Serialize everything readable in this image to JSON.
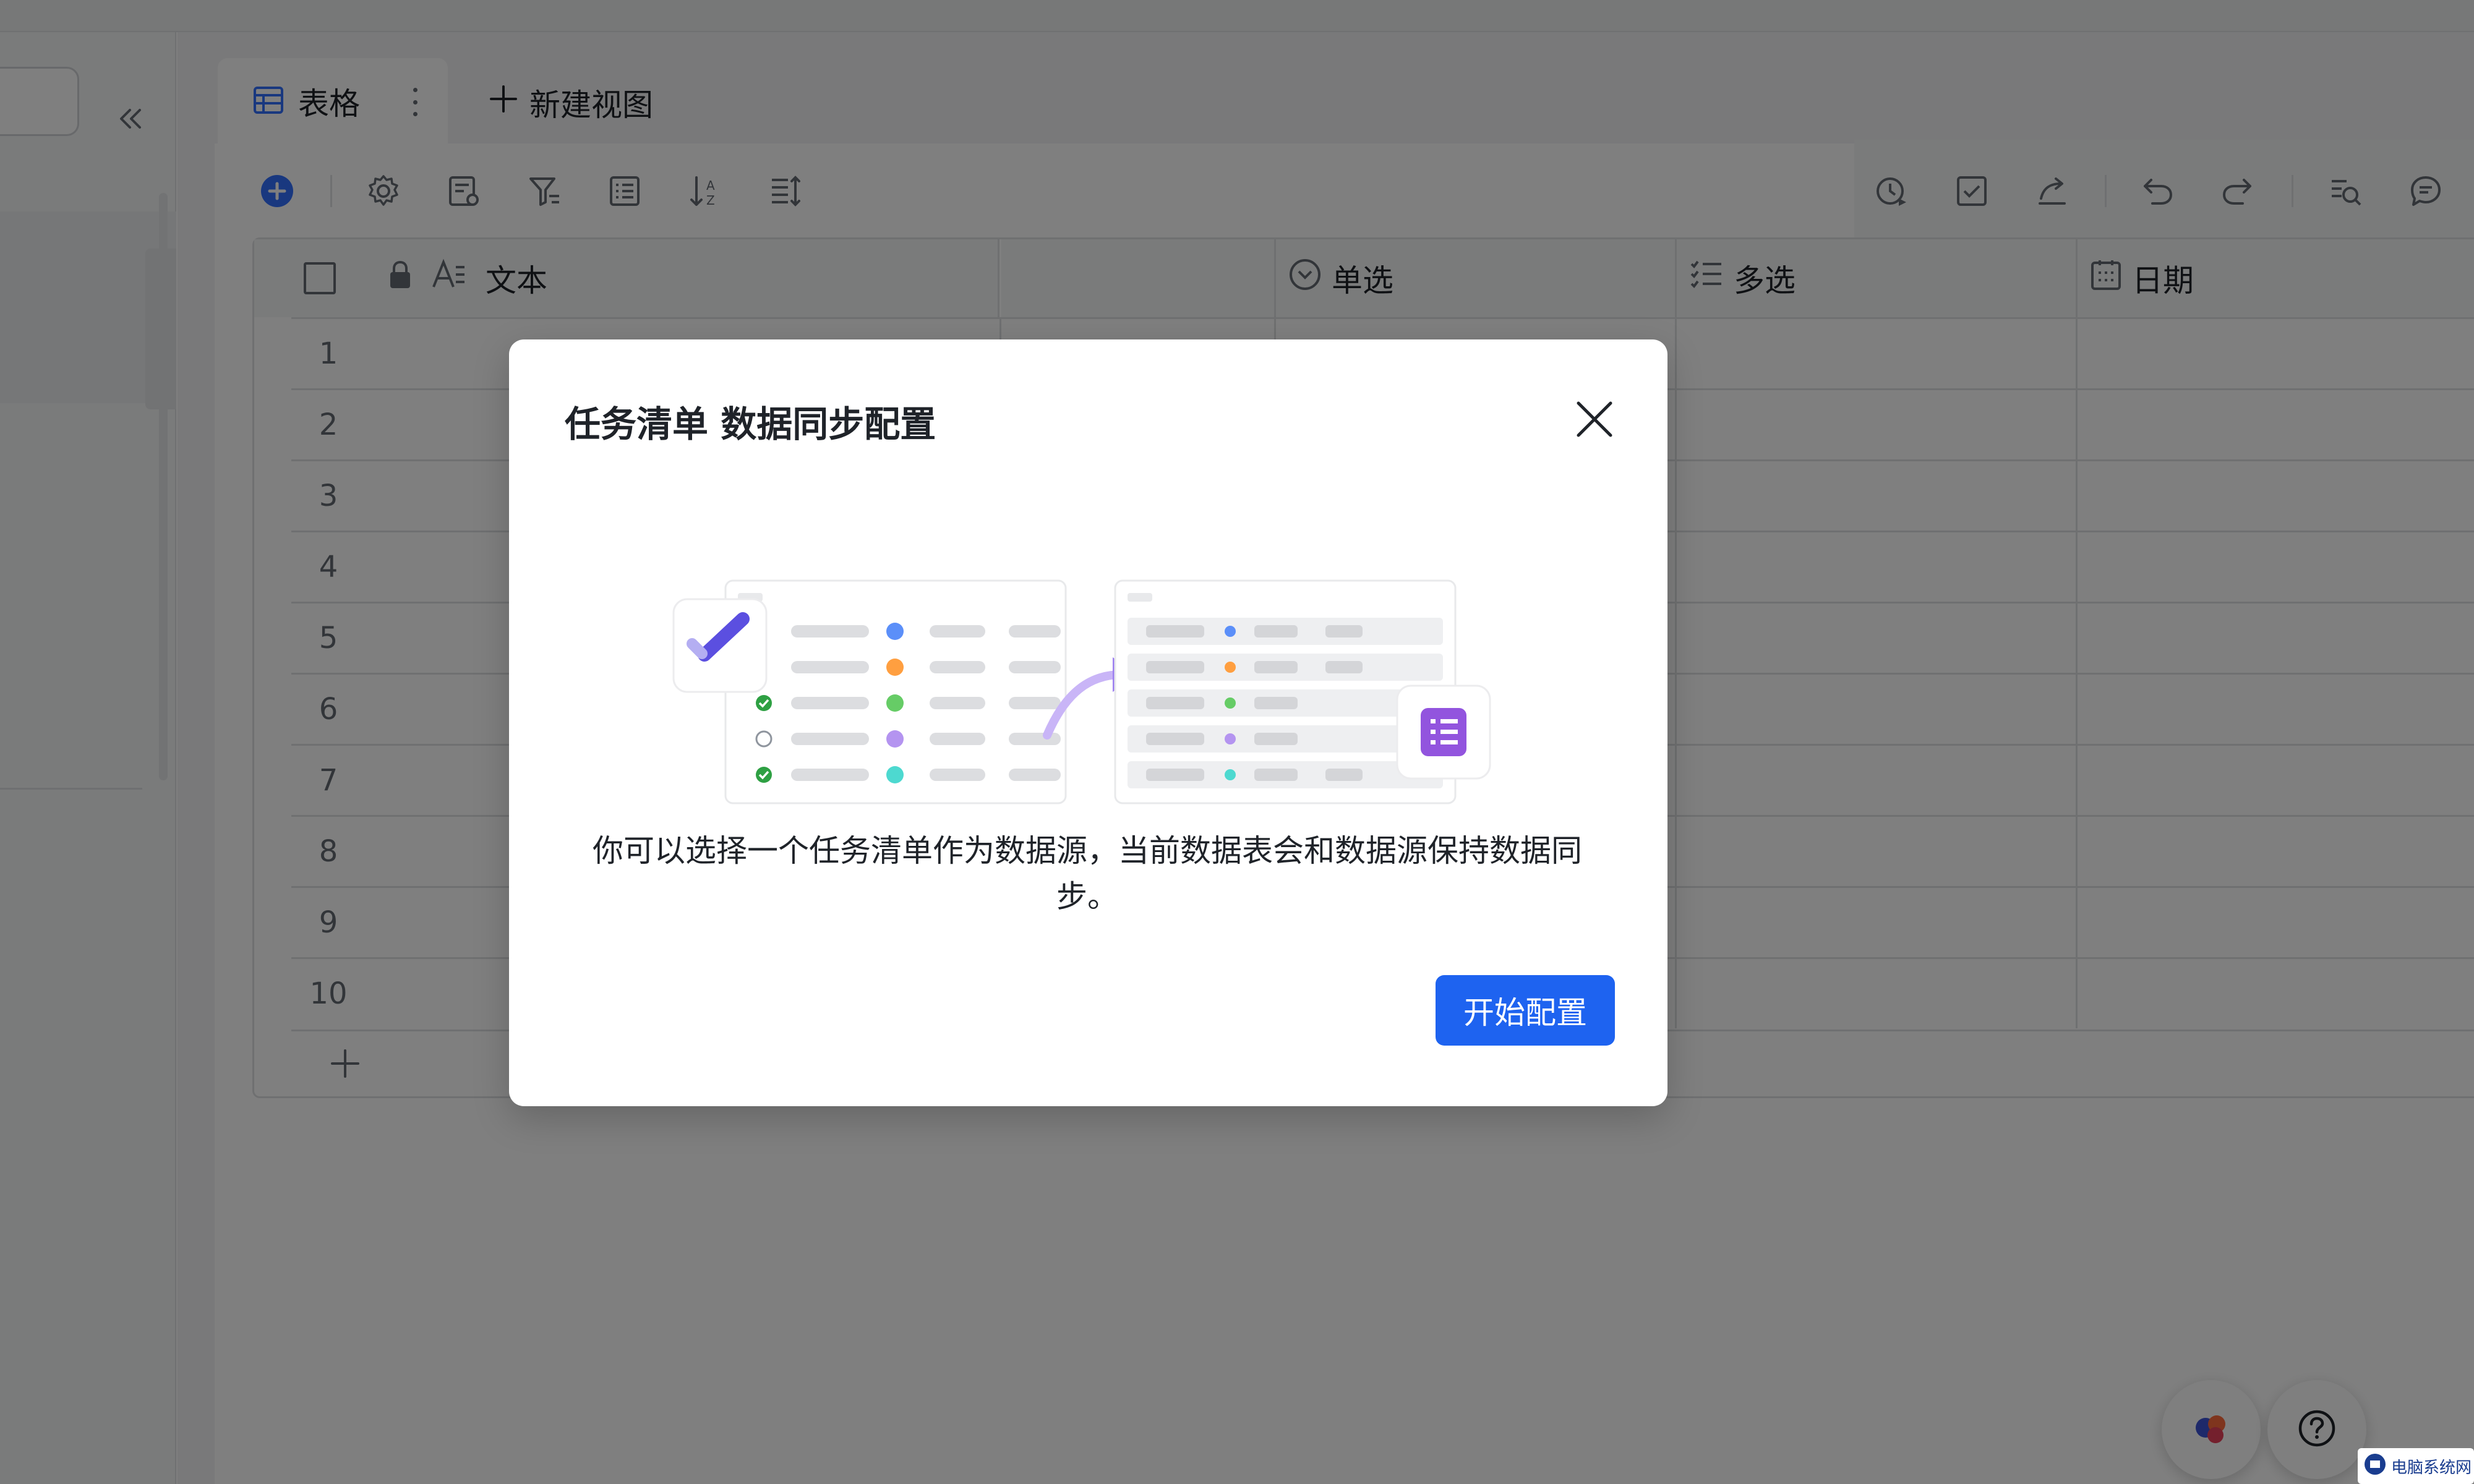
{
  "view_tab": {
    "label": "表格"
  },
  "new_view": {
    "label": "新建视图"
  },
  "columns": {
    "text": "文本",
    "single": "单选",
    "multi": "多选",
    "date": "日期"
  },
  "rows": [
    "1",
    "2",
    "3",
    "4",
    "5",
    "6",
    "7",
    "8",
    "9",
    "10"
  ],
  "modal": {
    "title": "任务清单 数据同步配置",
    "description": "你可以选择一个任务清单作为数据源，当前数据表会和数据源保持数据同步。",
    "button": "开始配置"
  },
  "watermark": {
    "text": "电脑系统网"
  },
  "colors": {
    "accent": "#1e63f0",
    "overlay": "rgba(0,0,0,0.5)",
    "task_purple": "#5b4fe0",
    "form_purple": "#9254de"
  },
  "icons": {
    "toolbar_left": [
      "add-icon",
      "settings-icon",
      "field-settings-icon",
      "filter-icon",
      "group-icon",
      "sort-icon",
      "row-height-icon"
    ],
    "toolbar_right": [
      "history-icon",
      "checklist-icon",
      "share-icon",
      "undo-icon",
      "redo-icon",
      "search-icon",
      "comment-icon"
    ]
  }
}
